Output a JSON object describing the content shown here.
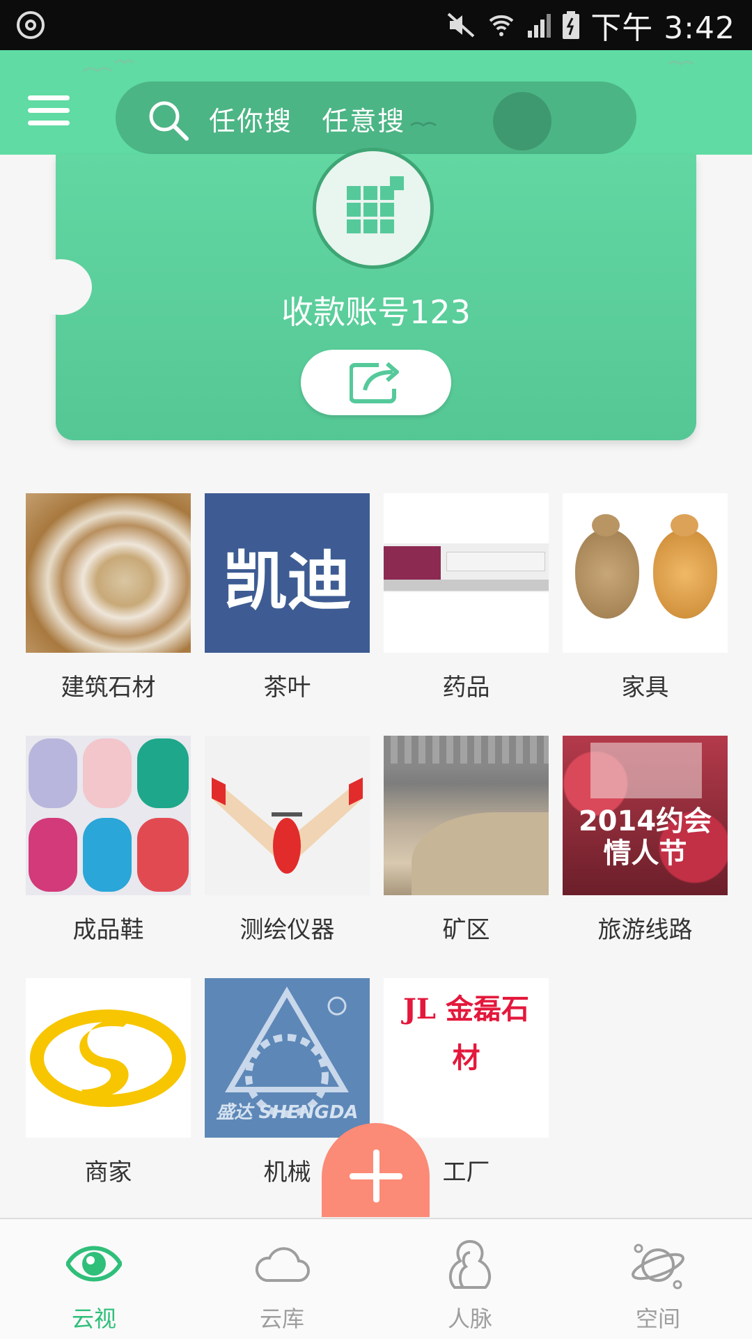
{
  "status_bar": {
    "time": "下午 3:42"
  },
  "header": {
    "search_placeholder": "任你搜   任意搜"
  },
  "card": {
    "title": "收款账号123"
  },
  "categories": [
    {
      "label": "建筑石材"
    },
    {
      "label": "茶叶",
      "image_text": "凯迪"
    },
    {
      "label": "药品"
    },
    {
      "label": "家具"
    },
    {
      "label": "成品鞋"
    },
    {
      "label": "测绘仪器"
    },
    {
      "label": "矿区"
    },
    {
      "label": "旅游线路",
      "image_text": "2014约会情人节"
    },
    {
      "label": "商家"
    },
    {
      "label": "机械",
      "image_text": "盛达 SHENGDA"
    },
    {
      "label": "工厂",
      "image_text": "JL 金磊石材"
    }
  ],
  "bottom_nav": [
    {
      "label": "云视",
      "icon": "eye-icon",
      "active": true
    },
    {
      "label": "云库",
      "icon": "cloud-icon",
      "active": false
    },
    {
      "label": "人脉",
      "icon": "contacts-icon",
      "active": false
    },
    {
      "label": "空间",
      "icon": "planet-icon",
      "active": false
    }
  ],
  "colors": {
    "accent": "#5fdba3",
    "active_nav": "#2fbf79",
    "fab": "#fb8a76"
  }
}
